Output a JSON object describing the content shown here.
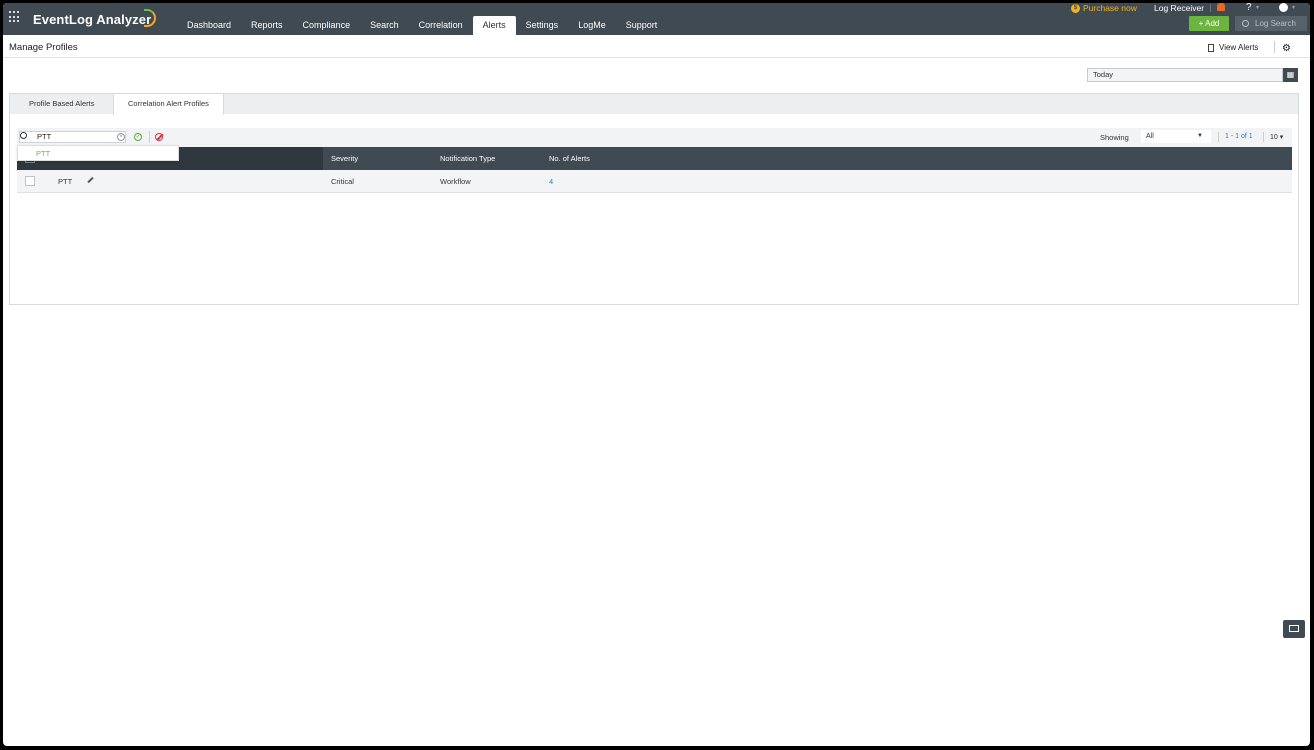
{
  "app": {
    "name": "EventLog Analyzer"
  },
  "nav": {
    "items": [
      {
        "label": "Dashboard",
        "active": false
      },
      {
        "label": "Reports",
        "active": false
      },
      {
        "label": "Compliance",
        "active": false
      },
      {
        "label": "Search",
        "active": false
      },
      {
        "label": "Correlation",
        "active": false
      },
      {
        "label": "Alerts",
        "active": true
      },
      {
        "label": "Settings",
        "active": false
      },
      {
        "label": "LogMe",
        "active": false
      },
      {
        "label": "Support",
        "active": false
      }
    ]
  },
  "topright": {
    "purchase_label": "Purchase now",
    "log_receiver_label": "Log Receiver",
    "help_label": "?",
    "add_label": "+ Add",
    "log_search_placeholder": "Log Search"
  },
  "page": {
    "title": "Manage Profiles",
    "view_alerts_label": "View Alerts",
    "date_range": "Today"
  },
  "tabs": [
    {
      "label": "Profile Based Alerts",
      "active": false
    },
    {
      "label": "Correlation Alert Profiles",
      "active": true
    }
  ],
  "toolbar": {
    "search_value": "PTT",
    "showing_label": "Showing",
    "showing_value": "All",
    "pager_text": "1 - 1 of 1",
    "page_size": "10"
  },
  "suggestion": {
    "text": "PTT"
  },
  "table": {
    "columns": [
      "Severity",
      "Notification Type",
      "No. of Alerts"
    ],
    "rows": [
      {
        "name": "PTT",
        "severity": "Critical",
        "notification_type": "Workflow",
        "alerts": "4"
      }
    ]
  },
  "colors": {
    "topbar": "#3f4a52",
    "accent_green": "#6cb33f",
    "purchase": "#f2b21d",
    "link": "#2b7bbf"
  }
}
